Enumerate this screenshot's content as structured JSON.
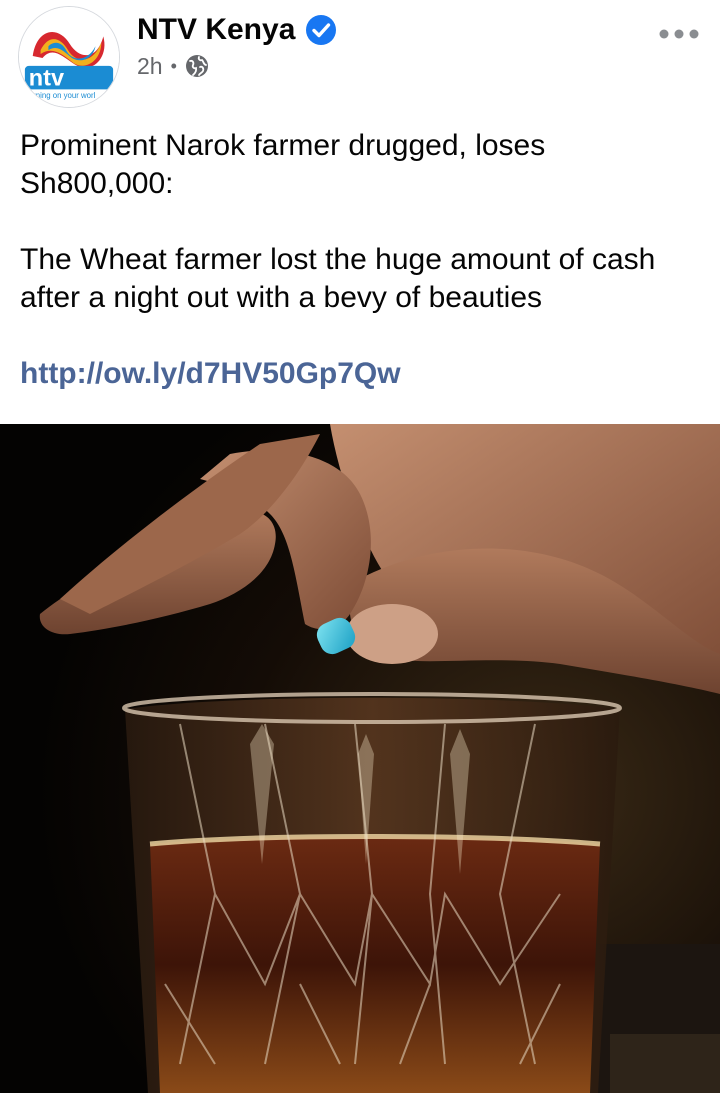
{
  "post": {
    "page_name": "NTV Kenya",
    "verified_icon": "verified-badge-icon",
    "time": "2h",
    "audience_icon": "globe-icon",
    "menu_icon": "more-options-icon",
    "avatar": {
      "brand_text": "ntv",
      "tagline": "urning on your worl"
    },
    "headline": "Prominent Narok farmer drugged, loses Sh800,000:",
    "body": "The Wheat farmer lost the huge amount of cash after a night out with a bevy of beauties",
    "link": "http://ow.ly/d7HV50Gp7Qw",
    "photo_icon": "pill-drop-into-glass-photo"
  },
  "colors": {
    "link": "#4b6596",
    "verified": "#1877f2",
    "meta": "#65676b",
    "ntv_red": "#d7282f",
    "ntv_blue": "#1b8cd3"
  }
}
